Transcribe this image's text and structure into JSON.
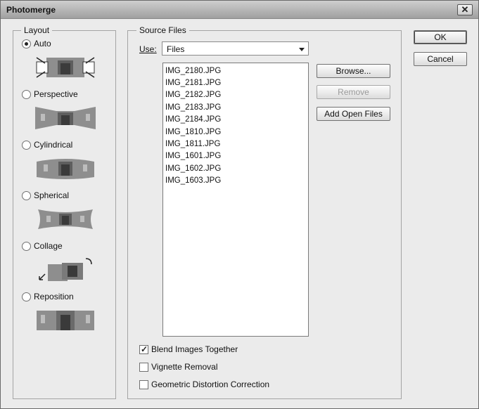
{
  "window": {
    "title": "Photomerge",
    "close_symbol": "✕"
  },
  "layout": {
    "label": "Layout",
    "selected": "Auto",
    "options": [
      {
        "label": "Auto",
        "checked": true
      },
      {
        "label": "Perspective",
        "checked": false
      },
      {
        "label": "Cylindrical",
        "checked": false
      },
      {
        "label": "Spherical",
        "checked": false
      },
      {
        "label": "Collage",
        "checked": false
      },
      {
        "label": "Reposition",
        "checked": false
      }
    ]
  },
  "source": {
    "label": "Source Files",
    "use_label": "Use:",
    "use_value": "Files",
    "files": [
      "IMG_2180.JPG",
      "IMG_2181.JPG",
      "IMG_2182.JPG",
      "IMG_2183.JPG",
      "IMG_2184.JPG",
      "IMG_1810.JPG",
      "IMG_1811.JPG",
      "IMG_1601.JPG",
      "IMG_1602.JPG",
      "IMG_1603.JPG"
    ]
  },
  "buttons": {
    "browse": "Browse...",
    "remove": "Remove",
    "add_open": "Add Open Files",
    "ok": "OK",
    "cancel": "Cancel"
  },
  "options": {
    "blend": {
      "label": "Blend Images Together",
      "checked": true
    },
    "vignette": {
      "label": "Vignette Removal",
      "checked": false
    },
    "distortion": {
      "label": "Geometric Distortion Correction",
      "checked": false
    }
  }
}
